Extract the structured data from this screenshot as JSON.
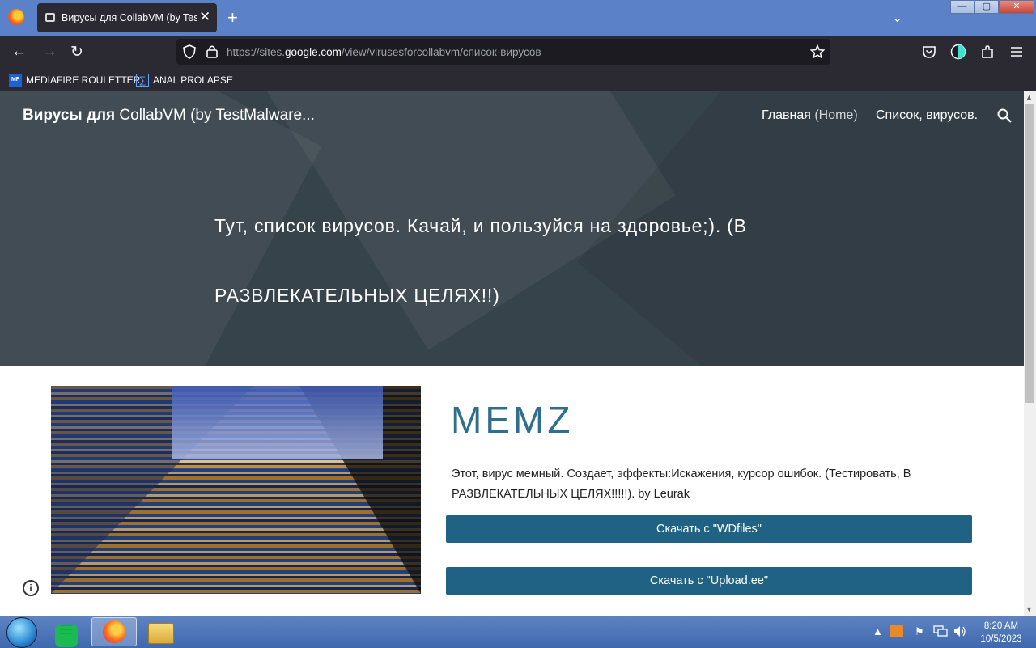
{
  "browser": {
    "tab": {
      "title": "Вирусы для CollabVM (by TestMalware)",
      "close": "✕"
    },
    "new_tab": "+",
    "tab_list": "⌄",
    "window_controls": {
      "minimize": "—",
      "maximize": "▢",
      "close": "✕"
    },
    "nav": {
      "back": "←",
      "forward": "→",
      "reload": "↻"
    },
    "url": {
      "prefix": "https://sites.",
      "domain": "google.com",
      "path": "/view/virusesforcollabvm/список-вирусов"
    },
    "bookmarks": [
      {
        "label": "MEDIAFIRE ROULETTER",
        "icon": "mediafire-icon",
        "icon_text": "MF"
      },
      {
        "label": "ANAL PROLAPSE",
        "icon": "sigma-icon",
        "icon_text": "∑"
      }
    ]
  },
  "site": {
    "title_bold": "Вирусы для",
    "title_rest": " CollabVM (by TestMalware...",
    "nav": [
      {
        "label": "Главная",
        "sub": " (Home)"
      },
      {
        "label": "Список, вирусов."
      }
    ],
    "hero_text": "Тут, список вирусов. Качай, и пользуйся на здоровье;). (В РАЗВЛЕКАТЕЛЬНЫХ ЦЕЛЯХ!!)"
  },
  "virus": {
    "name": "MEMZ",
    "description": "Этот, вирус мемный. Создает, эффекты:Искажения, курсор ошибок. (Тестировать, В РАЗВЛЕКАТЕЛЬНЫХ ЦЕЛЯХ!!!!!). by Leurak",
    "download_buttons": [
      {
        "label": "Скачать с \"WDfiles\""
      },
      {
        "label": "Скачать с \"Upload.ee\""
      }
    ]
  },
  "taskbar": {
    "time": "8:20 AM",
    "date": "10/5/2023"
  },
  "colors": {
    "hero_bg": "#37434b",
    "accent": "#2f6f8c",
    "button": "#1f6284",
    "taskbar": "#4a73b6",
    "tabstrip": "#5b82c9"
  }
}
